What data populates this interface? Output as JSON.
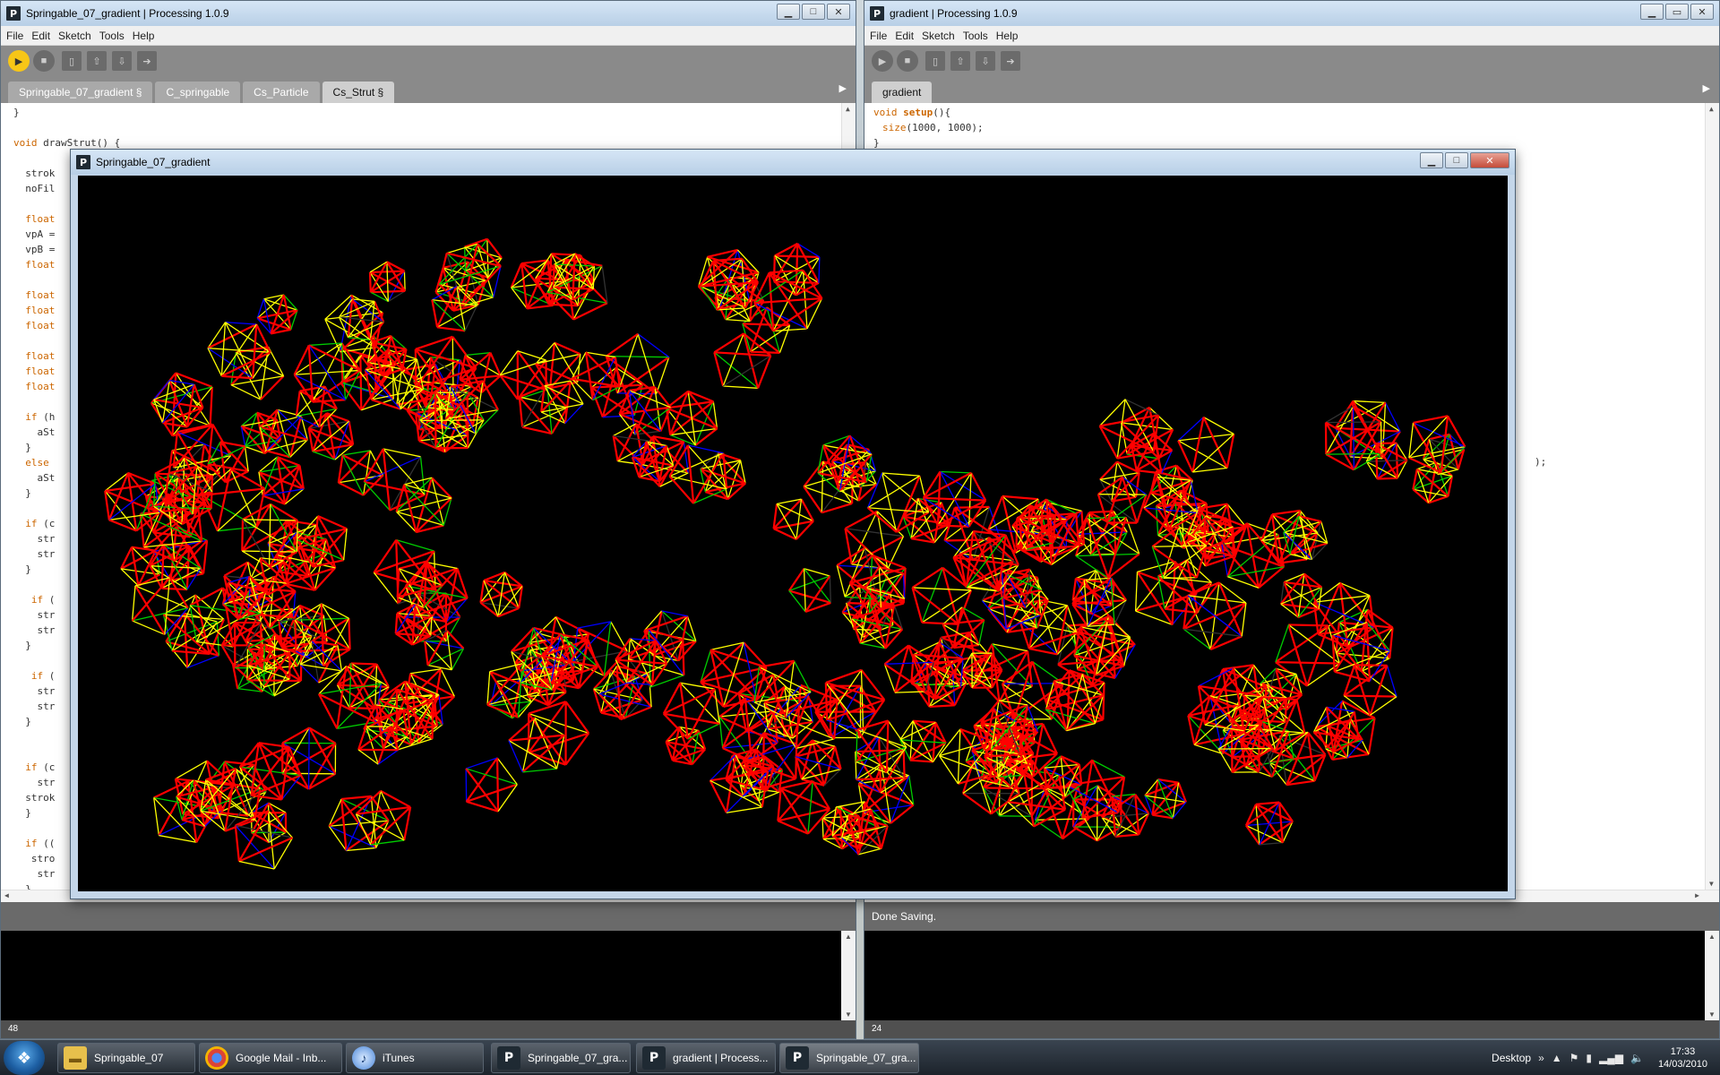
{
  "left_window": {
    "title": "Springable_07_gradient | Processing 1.0.9",
    "menu": [
      "File",
      "Edit",
      "Sketch",
      "Tools",
      "Help"
    ],
    "tabs": [
      "Springable_07_gradient §",
      "C_springable",
      "Cs_Particle",
      "Cs_Strut §"
    ],
    "active_tab": 3,
    "code": [
      "}",
      "",
      "void drawStrut() {",
      "",
      "  strok",
      "  noFil",
      "",
      "  float",
      "  vpA =",
      "  vpB =",
      "  float",
      "",
      "  float",
      "  float",
      "  float",
      "",
      "  float",
      "  float",
      "  float",
      "",
      "  if (h",
      "    aSt",
      "  }",
      "  else",
      "    aSt",
      "  }",
      "",
      "  if (c",
      "    str",
      "    str",
      "  }",
      "",
      "   if (",
      "    str",
      "    str",
      "  }",
      "",
      "   if (",
      "    str",
      "    str",
      "  }",
      "",
      "",
      "  if (c",
      "    str",
      "  strok",
      "  }",
      "",
      "  if ((",
      "   stro",
      "    str",
      "  }"
    ],
    "status_text": "",
    "line_number": "48"
  },
  "right_window": {
    "title": "gradient | Processing 1.0.9",
    "menu": [
      "File",
      "Edit",
      "Sketch",
      "Tools",
      "Help"
    ],
    "tabs": [
      "gradient"
    ],
    "code_setup_kw": "void",
    "code_setup_fn": "setup",
    "code_setup_rest": "(){",
    "code_size_fn": "size",
    "code_size_rest": "(1000, 1000);",
    "code_close": "}",
    "code_tail": ");",
    "status_text": "Done Saving.",
    "line_number": "24"
  },
  "sketch_window": {
    "title": "Springable_07_gradient",
    "stroke_colors": [
      "#ff0000",
      "#ffff00",
      "#00cc00",
      "#0000ff",
      "#333333"
    ]
  },
  "taskbar": {
    "start_glyph": "❖",
    "tasks": [
      {
        "label": "Springable_07",
        "icon": "folder-icon",
        "glyph": "▬"
      },
      {
        "label": "Google Mail - Inb...",
        "icon": "chrome-icon",
        "glyph": ""
      },
      {
        "label": "iTunes",
        "icon": "itunes-icon",
        "glyph": "♪"
      },
      {
        "label": "Springable_07_gra...",
        "icon": "processing-icon",
        "glyph": "P"
      },
      {
        "label": "gradient | Process...",
        "icon": "processing-icon",
        "glyph": "P"
      },
      {
        "label": "Springable_07_gra...",
        "icon": "processing-icon",
        "glyph": "P"
      }
    ],
    "tray_label": "Desktop",
    "tray_expand": "»",
    "tray_symbols": [
      "▲",
      "⚑",
      "▮",
      "▂▄▆",
      "🔈"
    ],
    "time": "17:33",
    "date": "14/03/2010"
  }
}
